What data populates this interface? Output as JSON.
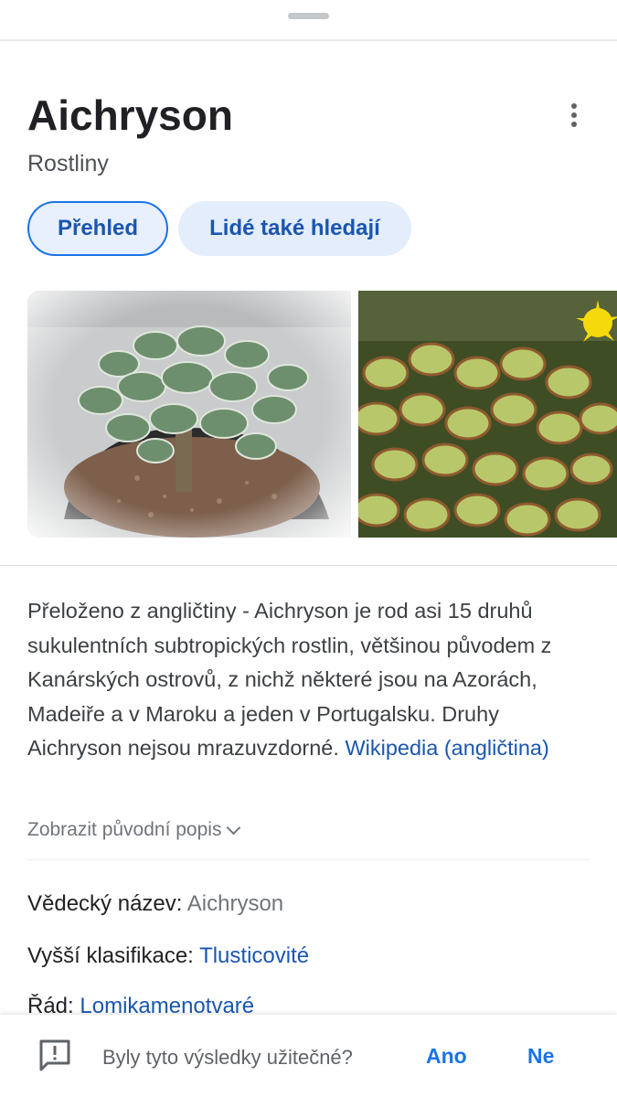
{
  "panel": {
    "title": "Aichryson",
    "subtitle": "Rostliny"
  },
  "tabs": [
    {
      "label": "Přehled",
      "active": true
    },
    {
      "label": "Lidé také hledají",
      "active": false
    }
  ],
  "description": {
    "text": "Přeloženo z angličtiny - Aichryson je rod asi 15 druhů sukulentních subtropických rostlin, většinou původem z Kanárských ostrovů, z nichž některé jsou na Azorách, Madeiře a v Maroku a jeden v Portugalsku. Druhy Aichryson nejsou mrazuvzdorné.",
    "source_link": "Wikipedia (angličtina)",
    "show_original": "Zobrazit původní popis"
  },
  "facts": [
    {
      "label": "Vědecký název:",
      "value": "Aichryson",
      "is_link": false
    },
    {
      "label": "Vyšší klasifikace:",
      "value": "Tlusticovité",
      "is_link": true
    },
    {
      "label": "Řád:",
      "value": "Lomikamenotvaré",
      "is_link": true
    }
  ],
  "feedback": {
    "question": "Byly tyto výsledky užitečné?",
    "yes": "Ano",
    "no": "Ne"
  },
  "icons": {
    "menu": "more-vert-icon",
    "expand": "chevron-down-icon",
    "feedback": "feedback-icon"
  },
  "colors": {
    "accent": "#1a73e8",
    "link": "#1a56b0",
    "chip_bg": "#e8f0fe"
  }
}
